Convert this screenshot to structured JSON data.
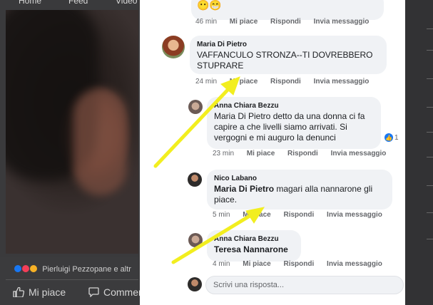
{
  "left": {
    "nav": {
      "home": "Home",
      "feed": "Feed",
      "video": "Video"
    },
    "reactions_text": "Pierluigi Pezzopane e altr",
    "like_label": "Mi piace",
    "comment_label": "Commen"
  },
  "top_comment": {
    "emojis": "😶😁",
    "time": "46 min",
    "like": "Mi piace",
    "reply": "Rispondi",
    "message": "Invia messaggio"
  },
  "comments": [
    {
      "author": "Maria Di Pietro",
      "text": "VAFFANCULO STRONZA--TI DOVREBBERO STUPRARE",
      "time": "24 min",
      "like": "Mi piace",
      "reply": "Rispondi",
      "message": "Invia messaggio"
    },
    {
      "author": "Anna Chiara Bezzu",
      "text": "Maria Di Pietro detto da una donna ci fa capire a che livelli siamo arrivati. Si vergogni e mi auguro la denunci",
      "time": "23 min",
      "like": "Mi piace",
      "reply": "Rispondi",
      "message": "Invia messaggio",
      "reaction_count": "1"
    },
    {
      "author": "Nico Labano",
      "mention": "Maria Di Pietro",
      "text": " magari alla nannarone gli piace.",
      "time": "5 min",
      "like": "Mi piace",
      "reply": "Rispondi",
      "message": "Invia messaggio"
    },
    {
      "author": "Anna Chiara Bezzu",
      "mention": "Teresa Nannarone",
      "time": "4 min",
      "like": "Mi piace",
      "reply": "Rispondi",
      "message": "Invia messaggio"
    }
  ],
  "reply_placeholder": "Scrivi una risposta...",
  "colors": {
    "arrow": "#f2ee1f",
    "link_blue": "#1877f2"
  }
}
